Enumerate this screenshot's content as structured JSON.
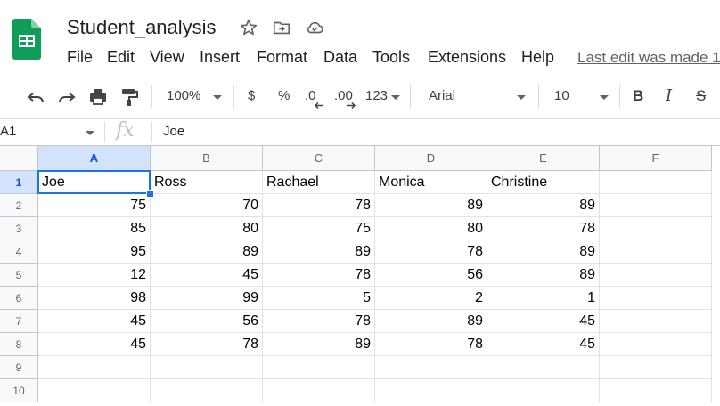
{
  "app": {
    "title": "Student_analysis",
    "last_edit": "Last edit was made 1",
    "brand_color": "#0f9d58"
  },
  "menu": [
    "File",
    "Edit",
    "View",
    "Insert",
    "Format",
    "Data",
    "Tools",
    "Extensions",
    "Help"
  ],
  "toolbar": {
    "zoom": "100%",
    "currency": "$",
    "percent": "%",
    "decrease_decimal": ".0",
    "increase_decimal": ".00",
    "more_formats": "123",
    "font": "Arial",
    "font_size": "10",
    "bold": "B",
    "italic": "I",
    "strike": "S"
  },
  "formula_bar": {
    "cell_ref": "A1",
    "fx": "fx",
    "value": "Joe"
  },
  "sheet": {
    "columns": [
      "A",
      "B",
      "C",
      "D",
      "E",
      "F"
    ],
    "rows": [
      "1",
      "2",
      "3",
      "4",
      "5",
      "6",
      "7",
      "8",
      "9",
      "10"
    ],
    "header_row": [
      "Joe",
      "Ross",
      "Rachael",
      "Monica",
      "Christine"
    ],
    "data": [
      [
        "75",
        "70",
        "78",
        "89",
        "89"
      ],
      [
        "85",
        "80",
        "75",
        "80",
        "78"
      ],
      [
        "95",
        "89",
        "89",
        "78",
        "89"
      ],
      [
        "12",
        "45",
        "78",
        "56",
        "89"
      ],
      [
        "98",
        "99",
        "5",
        "2",
        "1"
      ],
      [
        "45",
        "56",
        "78",
        "89",
        "45"
      ],
      [
        "45",
        "78",
        "89",
        "78",
        "45"
      ]
    ],
    "selection_color": "#1a73e8"
  }
}
